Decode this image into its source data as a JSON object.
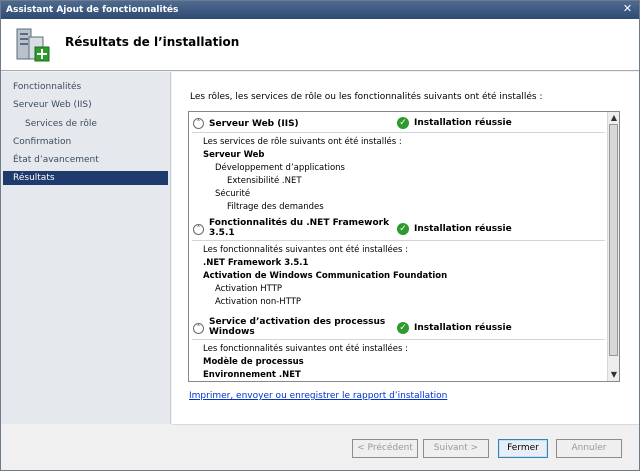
{
  "window": {
    "title": "Assistant Ajout de fonctionnalités"
  },
  "header": {
    "title": "Résultats de l’installation"
  },
  "sidebar": {
    "items": [
      {
        "label": "Fonctionnalités"
      },
      {
        "label": "Serveur Web (IIS)"
      },
      {
        "label": "Services de rôle"
      },
      {
        "label": "Confirmation"
      },
      {
        "label": "État d’avancement"
      },
      {
        "label": "Résultats"
      }
    ]
  },
  "main": {
    "intro": "Les rôles, les services de rôle ou les fonctionnalités suivants ont été installés :",
    "sections": [
      {
        "title": "Serveur Web (IIS)",
        "status": "Installation réussie",
        "lines": [
          "Les services de rôle suivants ont été installés :",
          "Serveur Web",
          "Développement d’applications",
          "Extensibilité .NET",
          "Sécurité",
          "Filtrage des demandes"
        ]
      },
      {
        "title_line1": "Fonctionnalités du .NET Framework",
        "title_line2": "3.5.1",
        "status": "Installation réussie",
        "lines": [
          "Les fonctionnalités suivantes ont été installées :",
          ".NET Framework 3.5.1",
          "Activation de Windows Communication Foundation",
          "Activation HTTP",
          "Activation non-HTTP"
        ]
      },
      {
        "title_line1": "Service d’activation des processus",
        "title_line2": "Windows",
        "status": "Installation réussie",
        "lines": [
          "Les fonctionnalités suivantes ont été installées :",
          "Modèle de processus",
          "Environnement .NET"
        ]
      }
    ],
    "link": "Imprimer, envoyer ou enregistrer le rapport d’installation"
  },
  "footer": {
    "prev": "< Précédent",
    "next": "Suivant >",
    "close": "Fermer",
    "cancel": "Annuler"
  },
  "icons": {
    "close": "close-icon",
    "header": "server-add-icon",
    "collapse": "collapse-icon",
    "success": "success-check-icon"
  }
}
